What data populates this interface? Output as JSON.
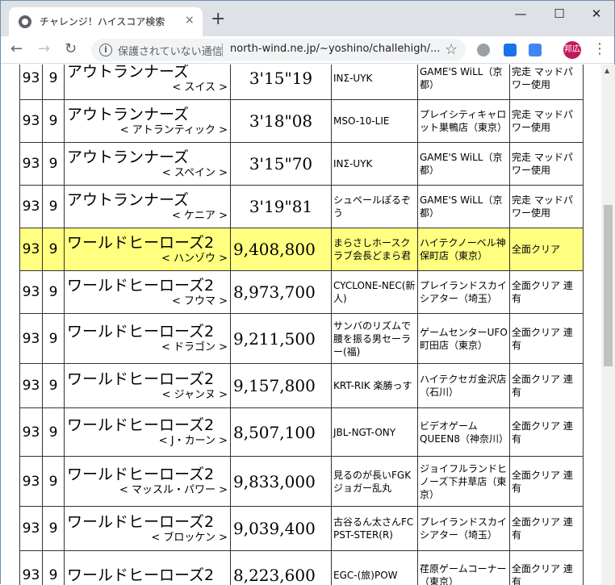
{
  "browser": {
    "tab_title": "チャレンジ！ハイスコア検索",
    "tab_close": "×",
    "new_tab": "+",
    "minimize": "—",
    "maximize": "☐",
    "close": "✕",
    "back": "←",
    "forward": "→",
    "reload": "↻",
    "security_text": "保護されていない通信",
    "url": "north-wind.ne.jp/~yoshino/challehigh/...",
    "bookmark_star": "☆",
    "avatar_label": "邦広",
    "menu_dots": "⋮"
  },
  "rows": [
    {
      "n1": "93",
      "n2": "9",
      "game": "アウトランナーズ",
      "sub": "< スイス >",
      "score": "3'15\"19",
      "player": "INΣ-UYK",
      "shop": "GAME'S WiLL（京都）",
      "note": "完走 マッドパワー使用",
      "highlight": false,
      "centered": true
    },
    {
      "n1": "93",
      "n2": "9",
      "game": "アウトランナーズ",
      "sub": "< アトランティック >",
      "score": "3'18\"08",
      "player": "MSO-10-LIE",
      "shop": "プレイシティキャロット巣鴨店（東京）",
      "note": "完走 マッドパワー使用",
      "highlight": false,
      "centered": true
    },
    {
      "n1": "93",
      "n2": "9",
      "game": "アウトランナーズ",
      "sub": "< スペイン >",
      "score": "3'15\"70",
      "player": "INΣ-UYK",
      "shop": "GAME'S WiLL（京都）",
      "note": "完走 マッドパワー使用",
      "highlight": false,
      "centered": true
    },
    {
      "n1": "93",
      "n2": "9",
      "game": "アウトランナーズ",
      "sub": "< ケニア >",
      "score": "3'19\"81",
      "player": "シュペールぽるぞう",
      "shop": "GAME'S WiLL（京都）",
      "note": "完走 マッドパワー使用",
      "highlight": false,
      "centered": true
    },
    {
      "n1": "93",
      "n2": "9",
      "game": "ワールドヒーローズ2",
      "sub": "< ハンゾウ >",
      "score": "9,408,800",
      "player": "まらさしホースクラブ会長どまら君",
      "shop": "ハイテクノーベル神保町店（東京）",
      "note": "全面クリア",
      "highlight": true,
      "centered": false
    },
    {
      "n1": "93",
      "n2": "9",
      "game": "ワールドヒーローズ2",
      "sub": "< フウマ >",
      "score": "8,973,700",
      "player": "CYCLONE-NEC(新人)",
      "shop": "プレイランドスカイシアター（埼玉）",
      "note": "全面クリア 連有",
      "highlight": false,
      "centered": false
    },
    {
      "n1": "93",
      "n2": "9",
      "game": "ワールドヒーローズ2",
      "sub": "< ドラゴン >",
      "score": "9,211,500",
      "player": "サンバのリズムで腰を振る男セーラー(福)",
      "shop": "ゲームセンターUFO町田店（東京）",
      "note": "全面クリア 連有",
      "highlight": false,
      "centered": false
    },
    {
      "n1": "93",
      "n2": "9",
      "game": "ワールドヒーローズ2",
      "sub": "< ジャンヌ >",
      "score": "9,157,800",
      "player": "KRT-RIK 楽勝っす",
      "shop": "ハイテクセガ金沢店（石川）",
      "note": "全面クリア 連有",
      "highlight": false,
      "centered": false
    },
    {
      "n1": "93",
      "n2": "9",
      "game": "ワールドヒーローズ2",
      "sub": "< J・カーン >",
      "score": "8,507,100",
      "player": "JBL-NGT-ONY",
      "shop": "ビデオゲームQUEEN8（神奈川）",
      "note": "全面クリア 連有",
      "highlight": false,
      "centered": false
    },
    {
      "n1": "93",
      "n2": "9",
      "game": "ワールドヒーローズ2",
      "sub": "< マッスル・パワー >",
      "score": "9,833,000",
      "player": "見るのが長いFGKジョガー乱丸",
      "shop": "ジョイフルランドヒノーズ下井草店（東京）",
      "note": "全面クリア 連有",
      "highlight": false,
      "centered": false
    },
    {
      "n1": "93",
      "n2": "9",
      "game": "ワールドヒーローズ2",
      "sub": "< ブロッケン >",
      "score": "9,039,400",
      "player": "古谷るん太さんFC PST-STER(R)",
      "shop": "プレイランドスカイシアター（埼玉）",
      "note": "全面クリア 連有",
      "highlight": false,
      "centered": false
    },
    {
      "n1": "93",
      "n2": "9",
      "game": "ワールドヒーローズ2",
      "sub": "",
      "score": "8,223,600",
      "player": "EGC-(旅)POW",
      "shop": "荏原ゲームコーナー（東京）",
      "note": "全面クリア 連有",
      "highlight": false,
      "centered": false
    }
  ]
}
